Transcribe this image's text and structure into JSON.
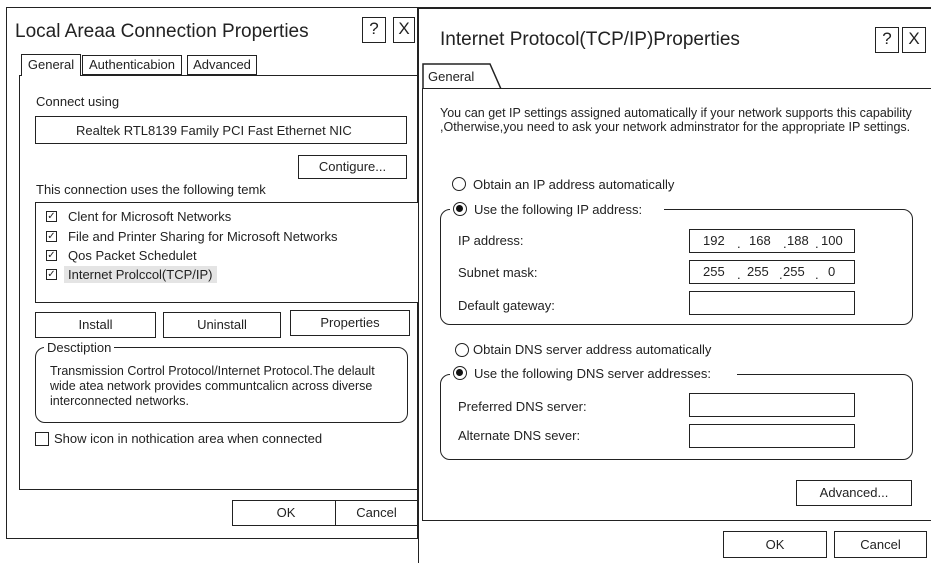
{
  "lan": {
    "title": "Local Areaa Connection Properties",
    "help_icon": "?",
    "close_icon": "X",
    "tabs": [
      "General",
      "Authenticabion",
      "Advanced"
    ],
    "connect_using_label": "Connect using",
    "adapter": "Realtek RTL8139 Family PCI Fast Ethernet NIC",
    "configure_btn": "Contigure...",
    "items_label": "This connection uses the following temk",
    "items": [
      {
        "label": "Clent for Microsoft Networks",
        "checked": true
      },
      {
        "label": "File and Printer Sharing for Microsoft Networks",
        "checked": true
      },
      {
        "label": "Qos Packet Schedulet",
        "checked": true
      },
      {
        "label": "Internet Prolccol(TCP/IP)",
        "checked": true
      }
    ],
    "install_btn": "Install",
    "uninstall_btn": "Uninstall",
    "properties_btn": "Properties",
    "description_label": "Desctiption",
    "description_text": "Transmission Cortrol Protocol/Internet Protocol.The delault wide atea network provides communtcalicn across diverse interconnected networks.",
    "show_icon_label": "Show icon in nothication area when connected",
    "ok_btn": "OK",
    "cancel_btn": "Cancel"
  },
  "tcpip": {
    "title": "Internet Protocol(TCP/IP)Properties",
    "help_icon": "?",
    "close_icon": "X",
    "tab": "General",
    "intro": "You can get IP settings assigned automatically if your network supports this capability ,Otherwise,you need to ask your network adminstrator for the appropriate IP settings.",
    "obtain_ip_auto": "Obtain an IP address automatically",
    "use_following_ip": "Use the following IP address:",
    "ip_label": "IP address:",
    "ip_value": [
      "192",
      "168",
      "188",
      "100"
    ],
    "subnet_label": "Subnet mask:",
    "subnet_value": [
      "255",
      "255",
      "255",
      "0"
    ],
    "gateway_label": "Default gateway:",
    "obtain_dns_auto": "Obtain DNS server address automatically",
    "use_following_dns": "Use the following DNS server addresses:",
    "preferred_dns_label": "Preferred DNS server:",
    "alternate_dns_label": "Alternate DNS sever:",
    "advanced_btn": "Advanced...",
    "ok_btn": "OK",
    "cancel_btn": "Cancel",
    "dot": "."
  }
}
